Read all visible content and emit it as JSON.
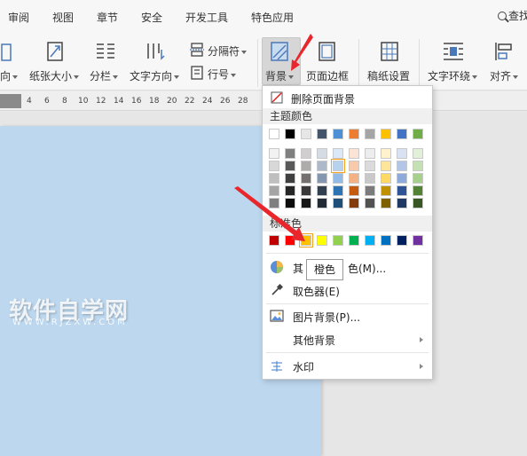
{
  "menu": {
    "items": [
      "审阅",
      "视图",
      "章节",
      "安全",
      "开发工具",
      "特色应用"
    ],
    "search_label": "查找"
  },
  "ribbon": {
    "direction_label": "向",
    "paper_size_label": "纸张大小",
    "columns_label": "分栏",
    "text_direction_label": "文字方向",
    "separator_label": "分隔符",
    "line_num_label": "行号",
    "background_label": "背景",
    "page_border_label": "页面边框",
    "grid_paper_label": "稿纸设置",
    "text_wrap_label": "文字环绕",
    "align_label": "对齐"
  },
  "ruler": {
    "ticks": [
      "4",
      "6",
      "8",
      "10",
      "12",
      "14",
      "16",
      "18",
      "20",
      "22",
      "24",
      "26",
      "28"
    ]
  },
  "document": {
    "watermark": "软件自学网",
    "watermark_sub": "WWW.RJZXW.COM"
  },
  "dropdown": {
    "remove_bg": "删除页面背景",
    "theme_colors_label": "主题颜色",
    "standard_colors_label": "标准色",
    "more_colors": "其他填充颜色(M)...",
    "more_colors_visible": "其",
    "more_colors_tail": "色(M)...",
    "eyedropper": "取色器(E)",
    "picture_bg": "图片背景(P)...",
    "other_bg": "其他背景",
    "watermark": "水印",
    "tooltip": "橙色",
    "theme_top_row": [
      "#ffffff",
      "#000000",
      "#e7e6e6",
      "#44546a",
      "#4f8fd6",
      "#ed7d31",
      "#a5a5a5",
      "#ffc000",
      "#4472c4",
      "#70ad47"
    ],
    "theme_shades": [
      [
        "#f2f2f2",
        "#7f7f7f",
        "#d0cece",
        "#d6dce4",
        "#dbe8f7",
        "#fbe4d5",
        "#ededed",
        "#fff2cc",
        "#d9e2f3",
        "#e2efd9"
      ],
      [
        "#d8d8d8",
        "#595959",
        "#aeabab",
        "#adb9ca",
        "#b7d2ef",
        "#f7caac",
        "#dbdbdb",
        "#fee599",
        "#b4c6e7",
        "#c5e0b3"
      ],
      [
        "#bfbfbf",
        "#3f3f3f",
        "#757070",
        "#8496b0",
        "#92bbe8",
        "#f4b183",
        "#c9c9c9",
        "#ffd965",
        "#8eaadb",
        "#a8d08d"
      ],
      [
        "#a5a5a5",
        "#262626",
        "#3a3838",
        "#323f4f",
        "#2e74b5",
        "#c55a11",
        "#7b7b7b",
        "#bf9000",
        "#2f5496",
        "#538135"
      ],
      [
        "#7f7f7f",
        "#0c0c0c",
        "#171616",
        "#222a35",
        "#1f4e79",
        "#833c0b",
        "#525252",
        "#7f6000",
        "#1f3864",
        "#375623"
      ]
    ],
    "standard_row": [
      "#c00000",
      "#ff0000",
      "#ffc000",
      "#ffff00",
      "#92d050",
      "#00b050",
      "#00b0f0",
      "#0070c0",
      "#002060",
      "#7030a0"
    ]
  }
}
